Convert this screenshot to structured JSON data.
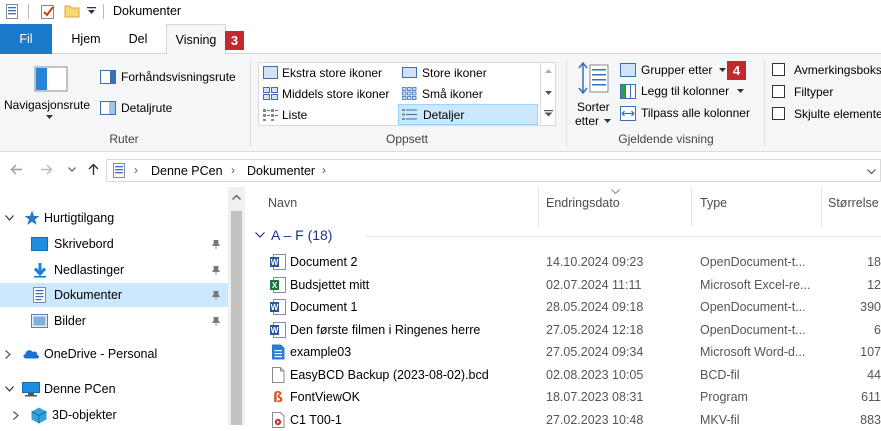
{
  "window": {
    "title": "Dokumenter"
  },
  "tabs": [
    {
      "label": "Fil"
    },
    {
      "label": "Hjem"
    },
    {
      "label": "Del"
    },
    {
      "label": "Visning"
    }
  ],
  "badges": {
    "visning": "3",
    "grupper": "4"
  },
  "ribbon": {
    "ruter": {
      "label": "Ruter",
      "navigasjonsrute": "Navigasjonsrute",
      "forhandsvisningsrute": "Forhåndsvisningsrute",
      "detaljrute": "Detaljrute"
    },
    "oppsett": {
      "label": "Oppsett",
      "items": [
        "Ekstra store ikoner",
        "Store ikoner",
        "Middels store ikoner",
        "Små ikoner",
        "Liste",
        "Detaljer"
      ]
    },
    "gjeldende": {
      "label": "Gjeldende visning",
      "sorter": "Sorter",
      "etter": "etter",
      "grupper": "Grupper etter",
      "legg_til": "Legg til kolonner",
      "tilpass": "Tilpass alle kolonner"
    },
    "vis": {
      "avmerkingsboks": "Avmerkingsboks",
      "filtyper": "Filtyper",
      "skjulte": "Skjulte elemente"
    }
  },
  "address": {
    "crumbs": [
      "Denne PCen",
      "Dokumenter"
    ],
    "separator": "›"
  },
  "nav": {
    "hurtigtilgang": "Hurtigtilgang",
    "items": [
      "Skrivebord",
      "Nedlastinger",
      "Dokumenter",
      "Bilder"
    ],
    "onedrive": "OneDrive - Personal",
    "denne_pcen": "Denne PCen",
    "objekter": "3D-objekter"
  },
  "columns": {
    "navn": "Navn",
    "endringsdato": "Endringsdato",
    "type": "Type",
    "storrelse": "Størrelse"
  },
  "group": {
    "label": "A – F (18)"
  },
  "files": [
    {
      "name": "Document 2",
      "date": "14.10.2024 09:23",
      "type": "OpenDocument-t...",
      "size": "18",
      "icon": "word-doc-icon"
    },
    {
      "name": "Budsjettet mitt",
      "date": "02.07.2024 11:11",
      "type": "Microsoft Excel-re...",
      "size": "12",
      "icon": "excel-sheet-icon"
    },
    {
      "name": "Document 1",
      "date": "28.05.2024 09:18",
      "type": "OpenDocument-t...",
      "size": "390",
      "icon": "word-doc-icon"
    },
    {
      "name": "Den første filmen i Ringenes herre",
      "date": "27.05.2024 12:18",
      "type": "OpenDocument-t...",
      "size": "6",
      "icon": "word-doc-icon"
    },
    {
      "name": "example03",
      "date": "27.05.2024 09:34",
      "type": "Microsoft Word-d...",
      "size": "107",
      "icon": "blue-doc-icon"
    },
    {
      "name": "EasyBCD Backup (2023-08-02).bcd",
      "date": "02.08.2023 10:05",
      "type": "BCD-fil",
      "size": "44",
      "icon": "blank-file-icon"
    },
    {
      "name": "FontViewOK",
      "date": "18.07.2023 08:31",
      "type": "Program",
      "size": "611",
      "icon": "program-icon"
    },
    {
      "name": "C1 T00-1",
      "date": "27.02.2023 10:48",
      "type": "MKV-fil",
      "size": "883",
      "icon": "video-file-icon"
    }
  ]
}
